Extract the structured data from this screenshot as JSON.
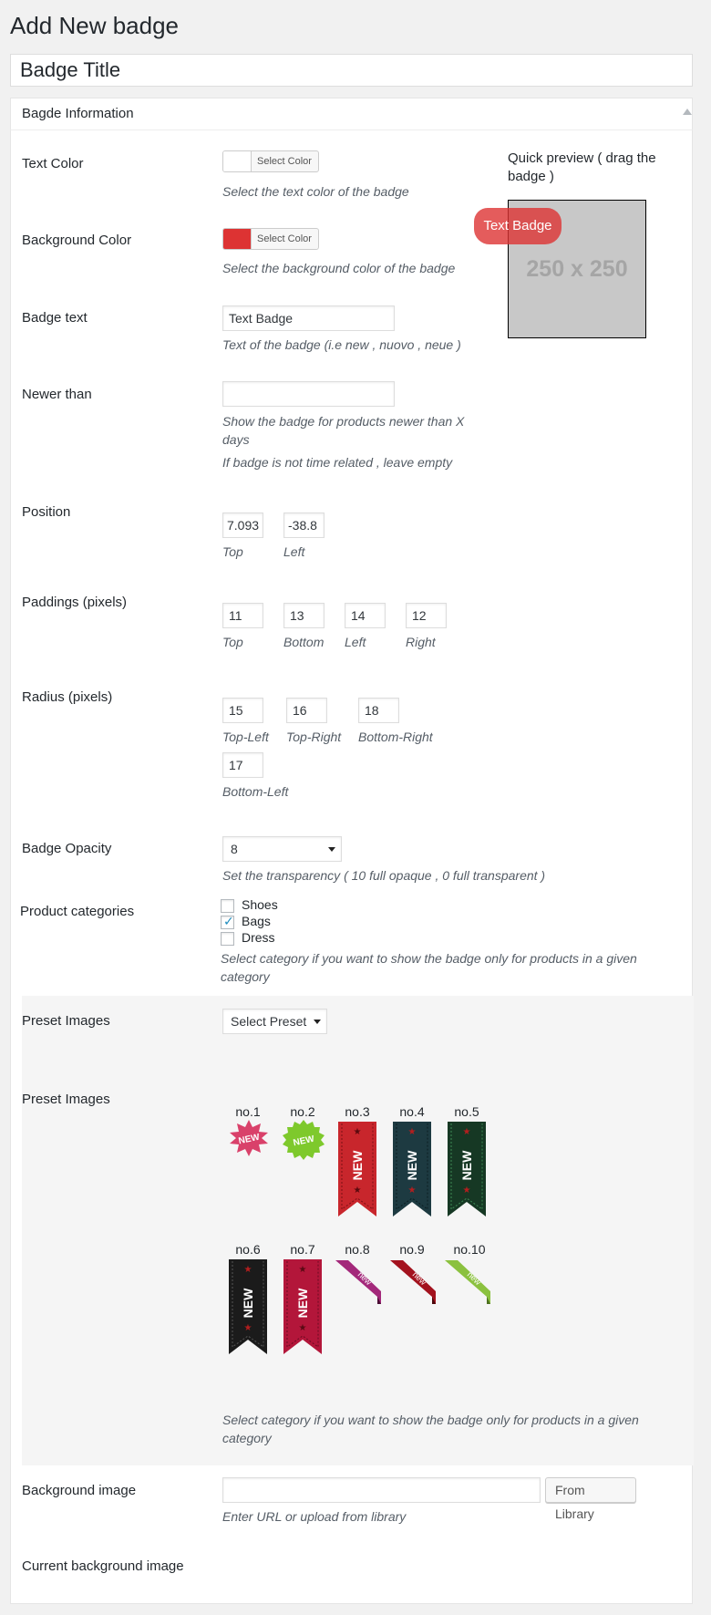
{
  "page_title": "Add New badge",
  "title_field": {
    "value": "Badge Title"
  },
  "panel": {
    "title": "Bagde Information"
  },
  "text_color": {
    "label": "Text Color",
    "button_label": "Select Color",
    "swatch_color": "#ffffff",
    "description": "Select the text color of the badge"
  },
  "background_color": {
    "label": "Background Color",
    "button_label": "Select Color",
    "swatch_color": "#dd3333",
    "description": "Select the background color of the badge"
  },
  "badge_text": {
    "label": "Badge text",
    "value": "Text Badge",
    "description": "Text of the badge (i.e new , nuovo , neue )"
  },
  "newer_than": {
    "label": "Newer than",
    "value": "",
    "description_1": "Show the badge for products newer than X days",
    "description_2": "If badge is not time related , leave empty"
  },
  "preview": {
    "title": "Quick preview ( drag the badge )",
    "box_text": "250 x 250",
    "badge_text": "Text Badge"
  },
  "position": {
    "label": "Position",
    "top_value": "7.093",
    "left_value": "-38.8",
    "top_label": "Top",
    "left_label": "Left"
  },
  "paddings": {
    "label": "Paddings (pixels)",
    "top": "11",
    "bottom": "13",
    "left": "14",
    "right": "12",
    "top_label": "Top",
    "bottom_label": "Bottom",
    "left_label": "Left",
    "right_label": "Right"
  },
  "radius": {
    "label": "Radius (pixels)",
    "top_left": "15",
    "top_right": "16",
    "bottom_right": "18",
    "bottom_left": "17",
    "top_left_label": "Top-Left",
    "top_right_label": "Top-Right",
    "bottom_right_label": "Bottom-Right",
    "bottom_left_label": "Bottom-Left"
  },
  "opacity": {
    "label": "Badge Opacity",
    "value": "8",
    "description": "Set the transparency ( 10 full opaque , 0 full transparent )"
  },
  "categories": {
    "label": "Product categories",
    "items": [
      {
        "name": "Shoes",
        "checked": false
      },
      {
        "name": "Bags",
        "checked": true
      },
      {
        "name": "Dress",
        "checked": false
      }
    ],
    "description": "Select category if you want to show the badge only for products in a given category"
  },
  "preset_select": {
    "label": "Preset Images",
    "value": "Select Preset"
  },
  "preset_images": {
    "label": "Preset Images",
    "items": [
      "no.1",
      "no.2",
      "no.3",
      "no.4",
      "no.5",
      "no.6",
      "no.7",
      "no.8",
      "no.9",
      "no.10"
    ],
    "ribbon_text": "NEW",
    "corner_text": "new",
    "description": "Select category if you want to show the badge only for products in a given category"
  },
  "background_image": {
    "label": "Background image",
    "value": "",
    "button_label": "From Library",
    "description": "Enter URL or upload from library"
  },
  "current_bg": {
    "label": "Current background image"
  },
  "colors": {
    "ribbon_red": "#c8262c",
    "ribbon_teal": "#1d3a41",
    "ribbon_green": "#163824",
    "ribbon_black": "#1b1b1b",
    "ribbon_crimson": "#b3163a",
    "star_pink": "#d9416a",
    "star_green": "#7ec92c",
    "corner_purple": "#a3287a",
    "corner_red": "#a3121e",
    "corner_green": "#8bc13f"
  }
}
